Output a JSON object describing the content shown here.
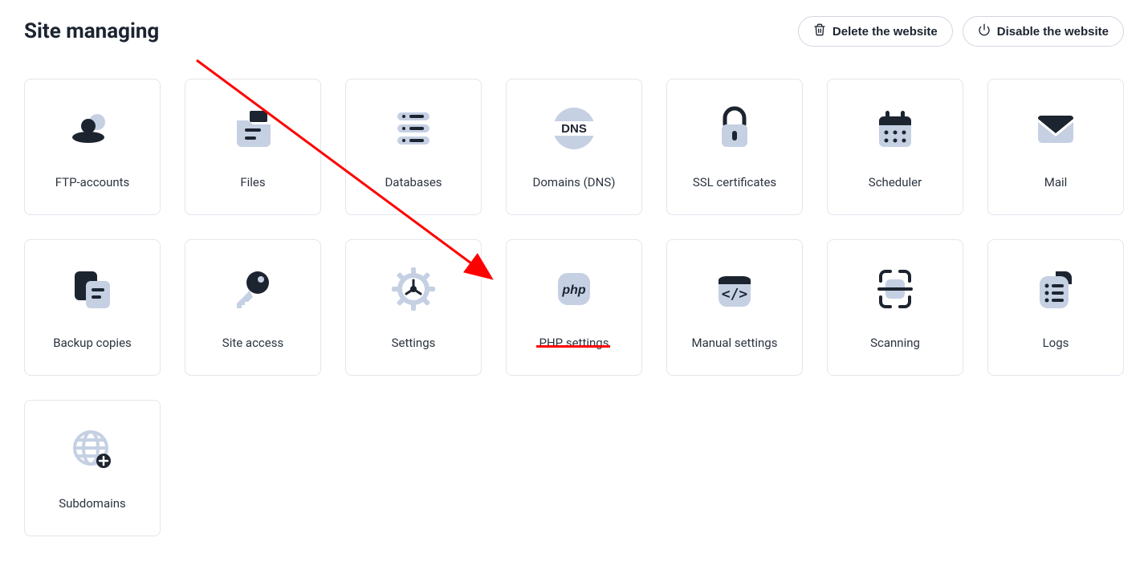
{
  "header": {
    "title": "Site managing",
    "delete_label": "Delete the website",
    "disable_label": "Disable the website"
  },
  "cards": [
    {
      "label": "FTP-accounts",
      "icon": "ftp-accounts-icon"
    },
    {
      "label": "Files",
      "icon": "files-icon"
    },
    {
      "label": "Databases",
      "icon": "databases-icon"
    },
    {
      "label": "Domains (DNS)",
      "icon": "dns-icon"
    },
    {
      "label": "SSL certificates",
      "icon": "ssl-icon"
    },
    {
      "label": "Scheduler",
      "icon": "scheduler-icon"
    },
    {
      "label": "Mail",
      "icon": "mail-icon"
    },
    {
      "label": "Backup copies",
      "icon": "backup-icon"
    },
    {
      "label": "Site access",
      "icon": "site-access-icon"
    },
    {
      "label": "Settings",
      "icon": "settings-icon"
    },
    {
      "label": "PHP settings",
      "icon": "php-settings-icon"
    },
    {
      "label": "Manual settings",
      "icon": "manual-settings-icon"
    },
    {
      "label": "Scanning",
      "icon": "scanning-icon"
    },
    {
      "label": "Logs",
      "icon": "logs-icon"
    },
    {
      "label": "Subdomains",
      "icon": "subdomains-icon"
    }
  ],
  "annotation": {
    "type": "arrow",
    "target": "PHP settings",
    "color": "#ff0000"
  }
}
